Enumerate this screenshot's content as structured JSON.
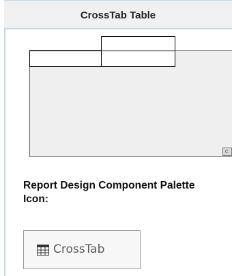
{
  "header": {
    "title": "CrossTab Table"
  },
  "preview": {
    "scroll_stub_text": "c"
  },
  "section": {
    "heading": "Report Design Component Palette Icon:"
  },
  "palette": {
    "label": "CrossTab",
    "icon": "table-grid-icon",
    "accent_color": "#333333"
  }
}
